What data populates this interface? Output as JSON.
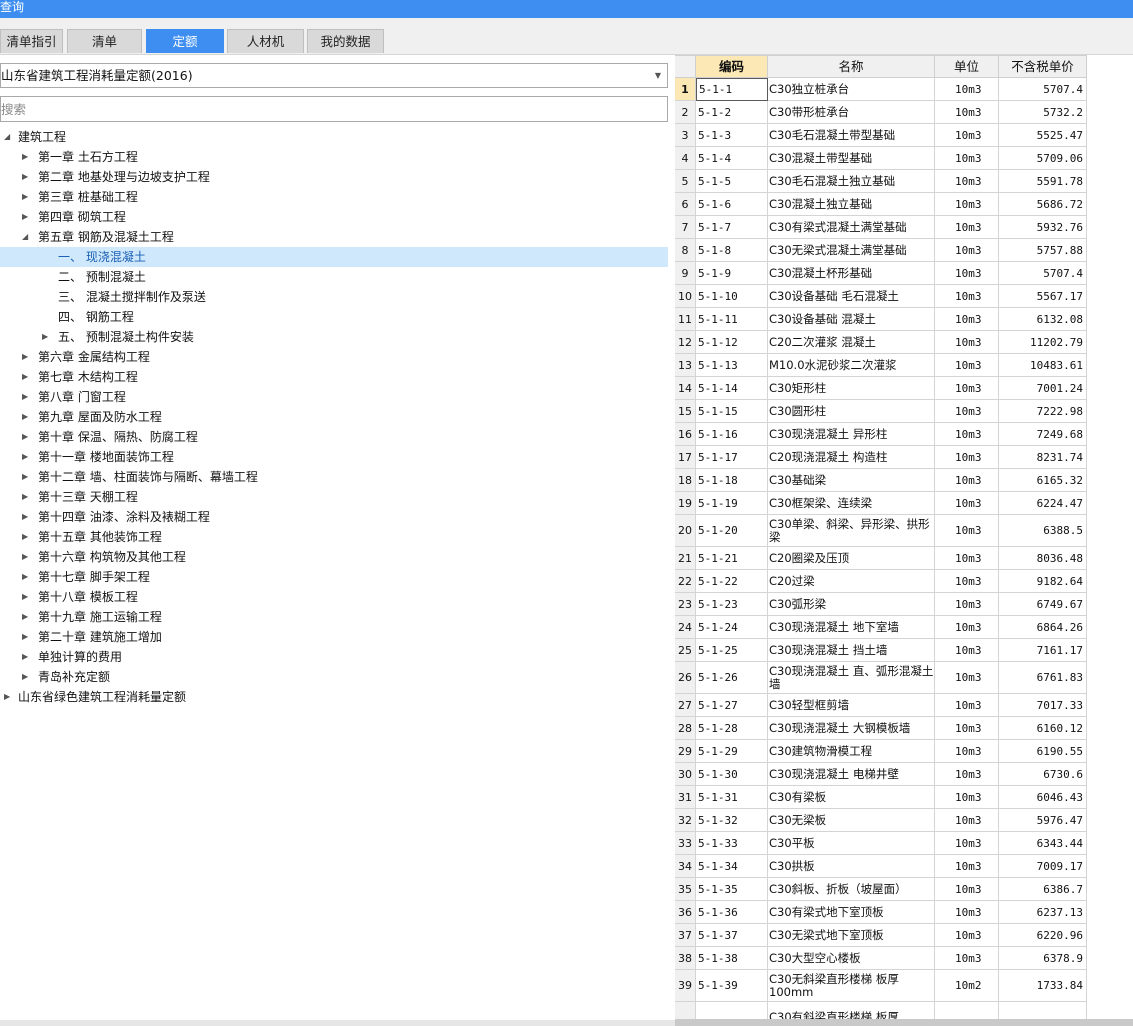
{
  "window": {
    "title": "查询"
  },
  "tabs": [
    {
      "label": "清单指引",
      "active": false
    },
    {
      "label": "清单",
      "active": false
    },
    {
      "label": "定额",
      "active": true
    },
    {
      "label": "人材机",
      "active": false
    },
    {
      "label": "我的数据",
      "active": false
    }
  ],
  "library_select": {
    "value": "山东省建筑工程消耗量定额(2016)"
  },
  "search": {
    "placeholder": "搜索"
  },
  "tree": [
    {
      "label": "建筑工程",
      "level": 0,
      "toggle": "expanded"
    },
    {
      "label": "第一章 土石方工程",
      "level": 1,
      "toggle": "collapsed"
    },
    {
      "label": "第二章 地基处理与边坡支护工程",
      "level": 1,
      "toggle": "collapsed"
    },
    {
      "label": "第三章 桩基础工程",
      "level": 1,
      "toggle": "collapsed"
    },
    {
      "label": "第四章 砌筑工程",
      "level": 1,
      "toggle": "collapsed"
    },
    {
      "label": "第五章 钢筋及混凝土工程",
      "level": 1,
      "toggle": "expanded"
    },
    {
      "label": "一、 现浇混凝土",
      "level": 2,
      "toggle": "none",
      "selected": true
    },
    {
      "label": "二、 预制混凝土",
      "level": 2,
      "toggle": "none"
    },
    {
      "label": "三、 混凝土搅拌制作及泵送",
      "level": 2,
      "toggle": "none"
    },
    {
      "label": "四、 钢筋工程",
      "level": 2,
      "toggle": "none"
    },
    {
      "label": "五、 预制混凝土构件安装",
      "level": 2,
      "toggle": "collapsed"
    },
    {
      "label": "第六章 金属结构工程",
      "level": 1,
      "toggle": "collapsed"
    },
    {
      "label": "第七章 木结构工程",
      "level": 1,
      "toggle": "collapsed"
    },
    {
      "label": "第八章 门窗工程",
      "level": 1,
      "toggle": "collapsed"
    },
    {
      "label": "第九章 屋面及防水工程",
      "level": 1,
      "toggle": "collapsed"
    },
    {
      "label": "第十章 保温、隔热、防腐工程",
      "level": 1,
      "toggle": "collapsed"
    },
    {
      "label": "第十一章 楼地面装饰工程",
      "level": 1,
      "toggle": "collapsed"
    },
    {
      "label": "第十二章 墙、柱面装饰与隔断、幕墙工程",
      "level": 1,
      "toggle": "collapsed"
    },
    {
      "label": "第十三章 天棚工程",
      "level": 1,
      "toggle": "collapsed"
    },
    {
      "label": "第十四章 油漆、涂料及裱糊工程",
      "level": 1,
      "toggle": "collapsed"
    },
    {
      "label": "第十五章 其他装饰工程",
      "level": 1,
      "toggle": "collapsed"
    },
    {
      "label": "第十六章 构筑物及其他工程",
      "level": 1,
      "toggle": "collapsed"
    },
    {
      "label": "第十七章 脚手架工程",
      "level": 1,
      "toggle": "collapsed"
    },
    {
      "label": "第十八章 模板工程",
      "level": 1,
      "toggle": "collapsed"
    },
    {
      "label": "第十九章 施工运输工程",
      "level": 1,
      "toggle": "collapsed"
    },
    {
      "label": "第二十章 建筑施工增加",
      "level": 1,
      "toggle": "collapsed"
    },
    {
      "label": "单独计算的费用",
      "level": 1,
      "toggle": "collapsed"
    },
    {
      "label": "青岛补充定额",
      "level": 1,
      "toggle": "collapsed"
    },
    {
      "label": "山东省绿色建筑工程消耗量定额",
      "level": 0,
      "toggle": "collapsed"
    }
  ],
  "table": {
    "headers": {
      "code": "编码",
      "name": "名称",
      "unit": "单位",
      "price": "不含税单价"
    },
    "rows": [
      {
        "n": "1",
        "code": "5-1-1",
        "name": "C30独立桩承台",
        "unit": "10m3",
        "price": "5707.4"
      },
      {
        "n": "2",
        "code": "5-1-2",
        "name": "C30带形桩承台",
        "unit": "10m3",
        "price": "5732.2"
      },
      {
        "n": "3",
        "code": "5-1-3",
        "name": "C30毛石混凝土带型基础",
        "unit": "10m3",
        "price": "5525.47"
      },
      {
        "n": "4",
        "code": "5-1-4",
        "name": "C30混凝土带型基础",
        "unit": "10m3",
        "price": "5709.06"
      },
      {
        "n": "5",
        "code": "5-1-5",
        "name": "C30毛石混凝土独立基础",
        "unit": "10m3",
        "price": "5591.78"
      },
      {
        "n": "6",
        "code": "5-1-6",
        "name": "C30混凝土独立基础",
        "unit": "10m3",
        "price": "5686.72"
      },
      {
        "n": "7",
        "code": "5-1-7",
        "name": "C30有梁式混凝土满堂基础",
        "unit": "10m3",
        "price": "5932.76"
      },
      {
        "n": "8",
        "code": "5-1-8",
        "name": "C30无梁式混凝土满堂基础",
        "unit": "10m3",
        "price": "5757.88"
      },
      {
        "n": "9",
        "code": "5-1-9",
        "name": "C30混凝土杯形基础",
        "unit": "10m3",
        "price": "5707.4"
      },
      {
        "n": "10",
        "code": "5-1-10",
        "name": "C30设备基础 毛石混凝土",
        "unit": "10m3",
        "price": "5567.17"
      },
      {
        "n": "11",
        "code": "5-1-11",
        "name": "C30设备基础 混凝土",
        "unit": "10m3",
        "price": "6132.08"
      },
      {
        "n": "12",
        "code": "5-1-12",
        "name": "C20二次灌浆 混凝土",
        "unit": "10m3",
        "price": "11202.79"
      },
      {
        "n": "13",
        "code": "5-1-13",
        "name": "M10.0水泥砂浆二次灌浆",
        "unit": "10m3",
        "price": "10483.61"
      },
      {
        "n": "14",
        "code": "5-1-14",
        "name": "C30矩形柱",
        "unit": "10m3",
        "price": "7001.24"
      },
      {
        "n": "15",
        "code": "5-1-15",
        "name": "C30圆形柱",
        "unit": "10m3",
        "price": "7222.98"
      },
      {
        "n": "16",
        "code": "5-1-16",
        "name": "C30现浇混凝土 异形柱",
        "unit": "10m3",
        "price": "7249.68"
      },
      {
        "n": "17",
        "code": "5-1-17",
        "name": "C20现浇混凝土 构造柱",
        "unit": "10m3",
        "price": "8231.74"
      },
      {
        "n": "18",
        "code": "5-1-18",
        "name": "C30基础梁",
        "unit": "10m3",
        "price": "6165.32"
      },
      {
        "n": "19",
        "code": "5-1-19",
        "name": "C30框架梁、连续梁",
        "unit": "10m3",
        "price": "6224.47"
      },
      {
        "n": "20",
        "code": "5-1-20",
        "name": "C30单梁、斜梁、异形梁、拱形梁",
        "unit": "10m3",
        "price": "6388.5",
        "tall": true
      },
      {
        "n": "21",
        "code": "5-1-21",
        "name": "C20圈梁及压顶",
        "unit": "10m3",
        "price": "8036.48"
      },
      {
        "n": "22",
        "code": "5-1-22",
        "name": "C20过梁",
        "unit": "10m3",
        "price": "9182.64"
      },
      {
        "n": "23",
        "code": "5-1-23",
        "name": "C30弧形梁",
        "unit": "10m3",
        "price": "6749.67"
      },
      {
        "n": "24",
        "code": "5-1-24",
        "name": "C30现浇混凝土 地下室墙",
        "unit": "10m3",
        "price": "6864.26"
      },
      {
        "n": "25",
        "code": "5-1-25",
        "name": "C30现浇混凝土 挡土墙",
        "unit": "10m3",
        "price": "7161.17"
      },
      {
        "n": "26",
        "code": "5-1-26",
        "name": "C30现浇混凝土 直、弧形混凝土墙",
        "unit": "10m3",
        "price": "6761.83",
        "tall": true
      },
      {
        "n": "27",
        "code": "5-1-27",
        "name": "C30轻型框剪墙",
        "unit": "10m3",
        "price": "7017.33"
      },
      {
        "n": "28",
        "code": "5-1-28",
        "name": "C30现浇混凝土 大钢模板墙",
        "unit": "10m3",
        "price": "6160.12"
      },
      {
        "n": "29",
        "code": "5-1-29",
        "name": "C30建筑物滑模工程",
        "unit": "10m3",
        "price": "6190.55"
      },
      {
        "n": "30",
        "code": "5-1-30",
        "name": "C30现浇混凝土 电梯井壁",
        "unit": "10m3",
        "price": "6730.6"
      },
      {
        "n": "31",
        "code": "5-1-31",
        "name": "C30有梁板",
        "unit": "10m3",
        "price": "6046.43"
      },
      {
        "n": "32",
        "code": "5-1-32",
        "name": "C30无梁板",
        "unit": "10m3",
        "price": "5976.47"
      },
      {
        "n": "33",
        "code": "5-1-33",
        "name": "C30平板",
        "unit": "10m3",
        "price": "6343.44"
      },
      {
        "n": "34",
        "code": "5-1-34",
        "name": "C30拱板",
        "unit": "10m3",
        "price": "7009.17"
      },
      {
        "n": "35",
        "code": "5-1-35",
        "name": "C30斜板、折板（坡屋面）",
        "unit": "10m3",
        "price": "6386.7"
      },
      {
        "n": "36",
        "code": "5-1-36",
        "name": "C30有梁式地下室顶板",
        "unit": "10m3",
        "price": "6237.13"
      },
      {
        "n": "37",
        "code": "5-1-37",
        "name": "C30无梁式地下室顶板",
        "unit": "10m3",
        "price": "6220.96"
      },
      {
        "n": "38",
        "code": "5-1-38",
        "name": "C30大型空心楼板",
        "unit": "10m3",
        "price": "6378.9"
      },
      {
        "n": "39",
        "code": "5-1-39",
        "name": "C30无斜梁直形楼梯 板厚100mm",
        "unit": "10m2",
        "price": "1733.84",
        "tall": true
      },
      {
        "n": "",
        "code": "",
        "name": "C30有斜梁直形楼梯 板厚",
        "unit": "",
        "price": "",
        "tall": true
      }
    ]
  }
}
